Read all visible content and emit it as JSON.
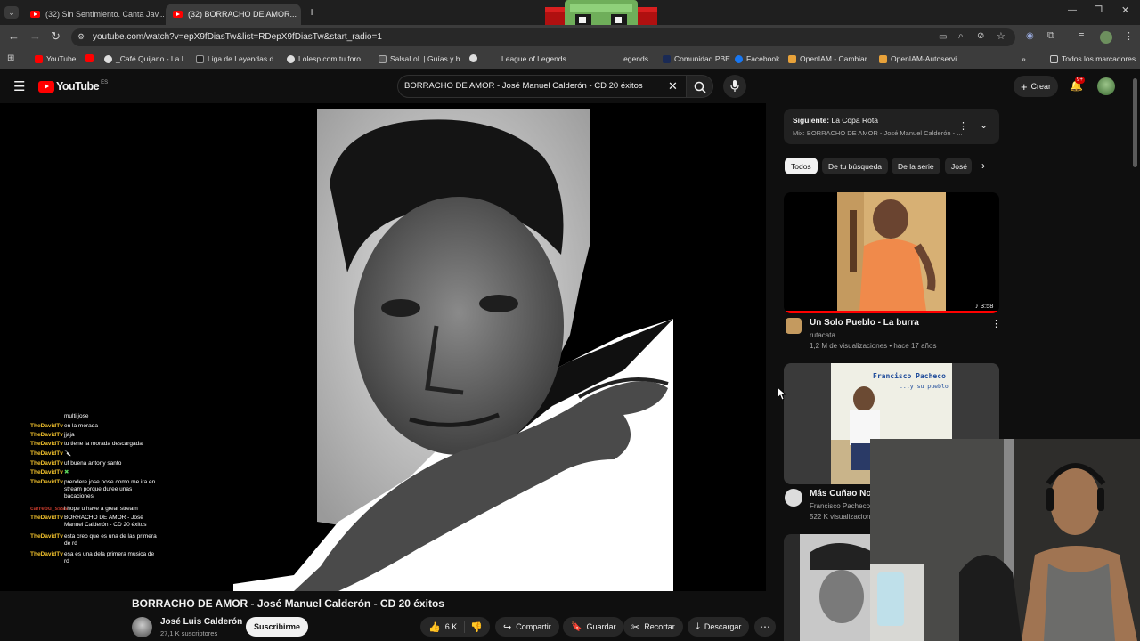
{
  "browser": {
    "tabs": [
      {
        "title": "(32) Sin Sentimiento. Canta Jav...",
        "active": false
      },
      {
        "title": "(32) BORRACHO DE AMOR...",
        "active": true
      }
    ],
    "url": "youtube.com/watch?v=epX9fDiasTw&list=RDepX9fDiasTw&start_radio=1",
    "bookmarks": [
      "YouTube",
      "_Café Quijano - La L...",
      "Liga de Leyendas d...",
      "Lolesp.com tu foro...",
      "SalsaLoL | Guías y b...",
      "League of Legends",
      "...egends...",
      "Comunidad PBE",
      "Facebook",
      "OpenIAM - Cambiar...",
      "OpenIAM-Autoservi..."
    ],
    "bookmarks_all": "Todos los marcadores"
  },
  "youtube": {
    "logo": "YouTube",
    "region": "ES",
    "search_value": "BORRACHO DE AMOR - José Manuel Calderón - CD 20 éxitos",
    "create_label": "Crear",
    "notif_badge": "9+"
  },
  "video": {
    "title": "BORRACHO DE AMOR - José Manuel Calderón - CD 20 éxitos",
    "channel": "José Luis Calderón",
    "subscribers": "27,1 K suscriptores",
    "subscribe_label": "Suscribirme",
    "likes": "6 K",
    "share": "Compartir",
    "save": "Guardar",
    "clip": "Recortar",
    "download": "Descargar"
  },
  "playlist": {
    "next_label": "Siguiente:",
    "next_title": "La Copa Rota",
    "mix_title": "Mix: BORRACHO DE AMOR - José Manuel Calderón - ..."
  },
  "chips": [
    "Todos",
    "De tu búsqueda",
    "De la serie",
    "José"
  ],
  "recommendations": [
    {
      "title": "Un Solo Pueblo - La burra",
      "channel": "rutacata",
      "meta": "1,2 M de visualizaciones • hace 17 años",
      "duration": "3:58"
    },
    {
      "title": "Más Cuñao No",
      "channel": "Francisco Pacheco &",
      "meta": "522 K visualizaciones",
      "thumb_text1": "Francisco Pacheco",
      "thumb_text2": "...y su pueblo"
    }
  ],
  "chat": [
    {
      "user": "",
      "msg": "multi jose"
    },
    {
      "user": "TheDavidTv",
      "msg": "en la morada"
    },
    {
      "user": "TheDavidTv",
      "msg": "jjaja"
    },
    {
      "user": "TheDavidTv",
      "msg": "tu tiene la morada descargada"
    },
    {
      "user": "TheDavidTv",
      "msg": "🔪"
    },
    {
      "user": "TheDavidTv",
      "msg": "uf buena antony santo"
    },
    {
      "user": "TheDavidTv",
      "msg": "✖"
    },
    {
      "user": "TheDavidTv",
      "msg": "prendere jose nose como me ira en stream porque duree unas bacaciones"
    },
    {
      "user": "carrebu_ssss",
      "msg": "i hope u have a great stream"
    },
    {
      "user": "TheDavidTv",
      "msg": "BORRACHO DE AMOR - José Manuel Calderón - CD 20 éxitos"
    },
    {
      "user": "TheDavidTv",
      "msg": "esta creo que es una de las primera de rd"
    },
    {
      "user": "TheDavidTv",
      "msg": "esa es una dela primera musica de rd"
    }
  ],
  "colors": {
    "accent_red": "#ff0000",
    "chat_user": "#f0c02c",
    "bg": "#0f0f0f"
  }
}
